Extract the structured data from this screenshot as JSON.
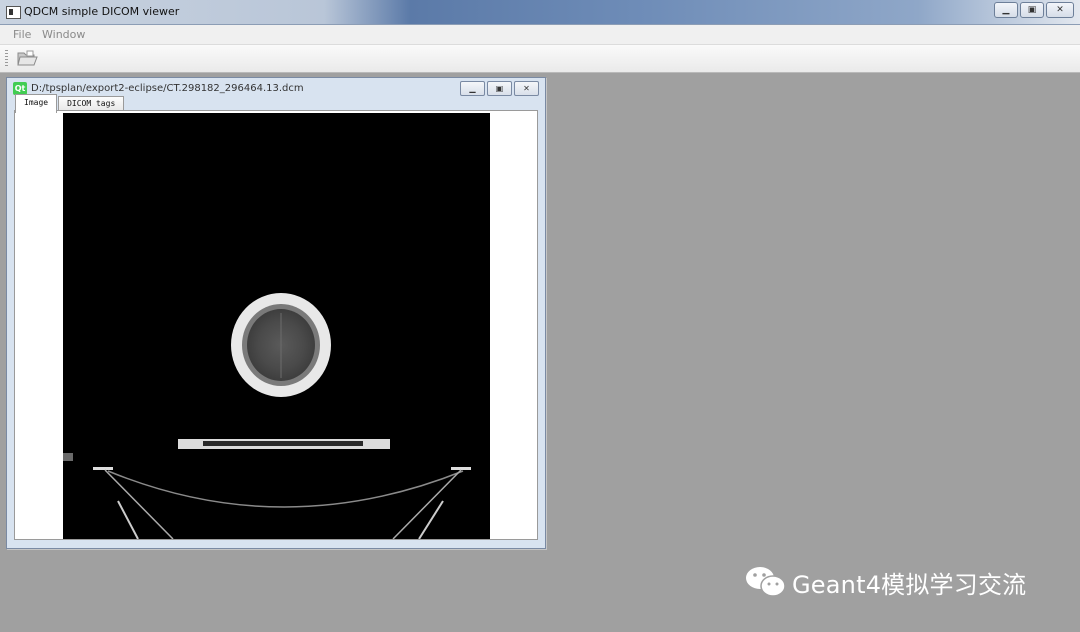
{
  "window": {
    "title": "QDCM simple DICOM viewer"
  },
  "menu": {
    "file": "File",
    "window": "Window"
  },
  "toolbar": {
    "open_icon": "folder-open-icon"
  },
  "child_window": {
    "path": "D:/tpsplan/export2-eclipse/CT.298182_296464.13.dcm",
    "qt_badge": "Qt",
    "tabs": [
      {
        "label": "Image"
      },
      {
        "label": "DICOM tags"
      }
    ]
  },
  "watermark": {
    "text": "Geant4模拟学习交流"
  },
  "colors": {
    "mdi_background": "#a0a0a0",
    "qt_green": "#41cd52",
    "image_background": "#000000"
  }
}
